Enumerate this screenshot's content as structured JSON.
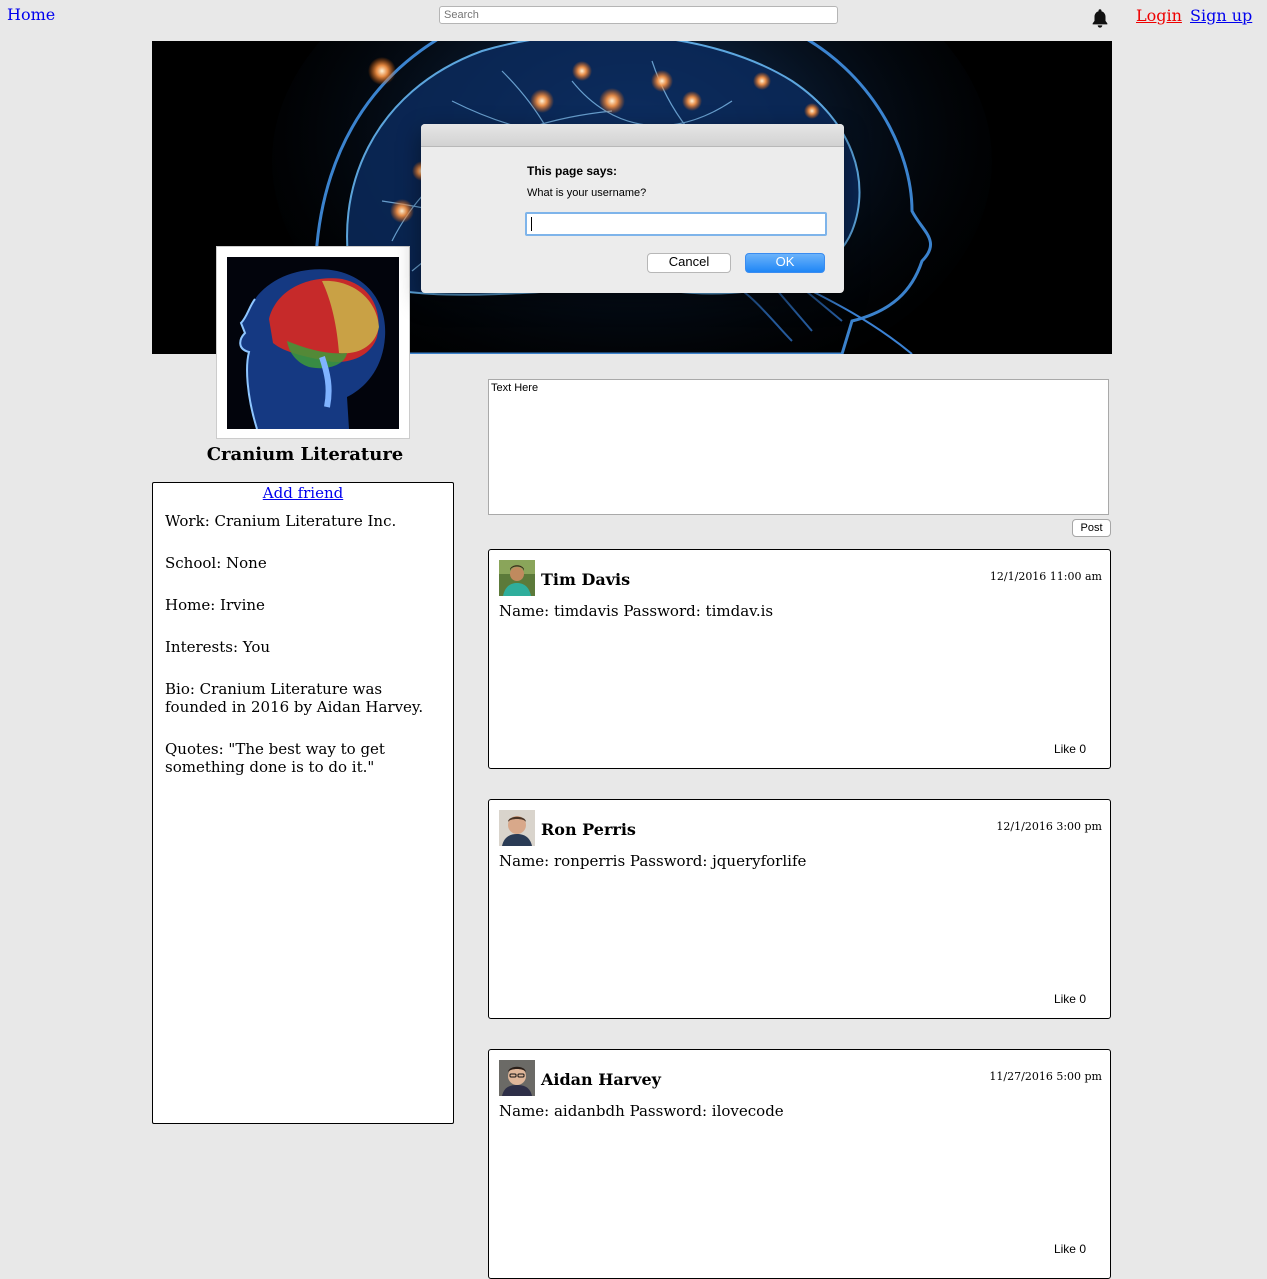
{
  "nav": {
    "home": "Home",
    "search_placeholder": "Search",
    "login": "Login",
    "signup": "Sign up"
  },
  "profile": {
    "name": "Cranium Literature",
    "add_friend": "Add friend",
    "details": [
      "Work: Cranium Literature Inc.",
      "School: None",
      "Home: Irvine",
      "Interests: You",
      "Bio: Cranium Literature was founded in 2016 by Aidan Harvey.",
      "Quotes: \"The best way to get something done is to do it.\""
    ]
  },
  "composer": {
    "placeholder": "Text Here",
    "post_button": "Post"
  },
  "posts": [
    {
      "author": "Tim Davis",
      "date": "12/1/2016 11:00 am",
      "body": "Name: timdavis Password: timdav.is",
      "like": "Like 0"
    },
    {
      "author": "Ron Perris",
      "date": "12/1/2016 3:00 pm",
      "body": "Name: ronperris Password: jqueryforlife",
      "like": "Like 0"
    },
    {
      "author": "Aidan Harvey",
      "date": "11/27/2016 5:00 pm",
      "body": "Name: aidanbdh Password: ilovecode",
      "like": "Like 0"
    }
  ],
  "dialog": {
    "heading": "This page says:",
    "question": "What is your username?",
    "input_value": "",
    "cancel": "Cancel",
    "ok": "OK"
  },
  "icons": {
    "notifications": "bell-icon"
  },
  "colors": {
    "link": "#0000ee",
    "login_link": "#ee0000",
    "page_bg": "#e8e8e8",
    "ok_button": "#1f86f6"
  }
}
